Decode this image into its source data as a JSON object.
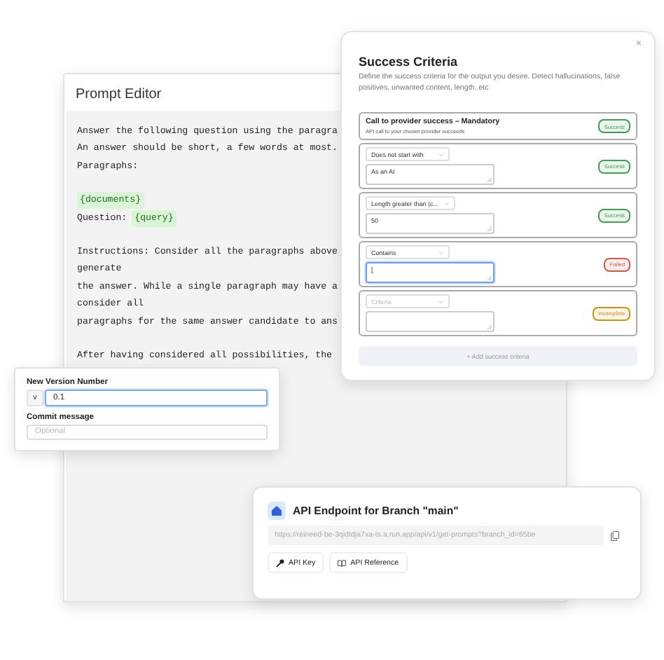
{
  "prompt_editor": {
    "title": "Prompt Editor",
    "paragraphs": [
      [
        [
          {
            "kind": "text",
            "text": "Answer the following question using the paragra"
          }
        ],
        [
          {
            "kind": "text",
            "text": "An answer should be short, a few words at most."
          }
        ],
        [
          {
            "kind": "text",
            "text": "Paragraphs:"
          }
        ]
      ],
      [
        [
          {
            "kind": "variable",
            "text": "{documents}"
          }
        ],
        [
          {
            "kind": "text",
            "text": "Question:"
          },
          {
            "kind": "variable",
            "text": "{query}"
          }
        ]
      ],
      [
        [
          {
            "kind": "text",
            "text": "Instructions: Consider all the paragraphs above"
          }
        ],
        [
          {
            "kind": "text",
            "text": "generate"
          }
        ],
        [
          {
            "kind": "text",
            "text": "the answer. While a single paragraph may have a"
          }
        ],
        [
          {
            "kind": "text",
            "text": "consider all"
          }
        ],
        [
          {
            "kind": "text",
            "text": "paragraphs for the same answer candidate to ans"
          }
        ]
      ],
      [
        [
          {
            "kind": "text",
            "text": "After having considered all possibilities, the"
          }
        ]
      ]
    ]
  },
  "success_criteria": {
    "close": "×",
    "title": "Success Criteria",
    "description": "Define the success criteria for the output you desire. Detect hallucinations, false positives, unwanted content, length, etc",
    "rows": [
      {
        "kind": "fixed",
        "title": "Call to provider success – Mandatory",
        "subtitle": "API call to your chosen provider succeeds",
        "color": "#3f9e52",
        "badge": "Success"
      },
      {
        "kind": "rule",
        "dropdown": "Does not start with",
        "input": "As an AI",
        "focused": false,
        "color": "#3f9e52",
        "badge": "Success"
      },
      {
        "kind": "rule",
        "dropdown": "Length greater than (c...",
        "input": "50",
        "focused": false,
        "color": "#3f9e52",
        "badge": "Success"
      },
      {
        "kind": "rule",
        "dropdown": "Contains",
        "input": "[",
        "focused": true,
        "color": "#d8574a",
        "badge": "Failed"
      },
      {
        "kind": "rule",
        "dropdown_placeholder": "Criteria",
        "focused": false,
        "color": "#c99414",
        "badge": "Incomplete"
      }
    ],
    "add_button": "+ Add success criteria"
  },
  "version_form": {
    "version_label": "New Version Number",
    "prefix": "v",
    "version": "0.1",
    "version_focused": true,
    "commit_label": "Commit message",
    "commit_placeholder": "Optional"
  },
  "api_endpoint": {
    "title": "API Endpoint for Branch \"main\"",
    "url": "https://reineed-be-3qidtdja7xa-ts.a.run.app/api/v1/get-prompts?branch_id=65be",
    "buttons": [
      {
        "kind": "key",
        "label": "API Key"
      },
      {
        "kind": "book",
        "label": "API Reference"
      }
    ]
  }
}
